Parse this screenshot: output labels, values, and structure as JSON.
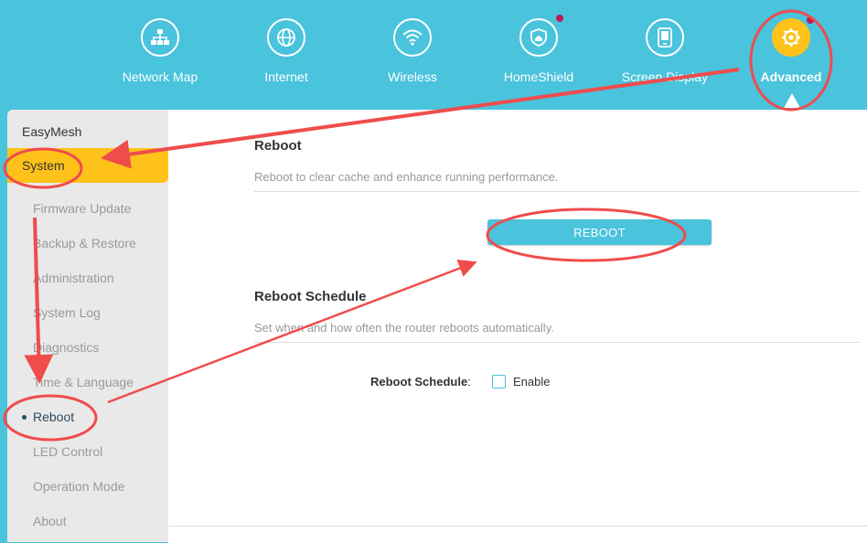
{
  "nav": {
    "items": [
      {
        "label": "Network Map",
        "icon": "network-map-icon"
      },
      {
        "label": "Internet",
        "icon": "globe-icon"
      },
      {
        "label": "Wireless",
        "icon": "wifi-icon"
      },
      {
        "label": "HomeShield",
        "icon": "shield-home-icon"
      },
      {
        "label": "Screen Display",
        "icon": "screen-display-icon"
      },
      {
        "label": "Advanced",
        "icon": "gear-icon"
      }
    ]
  },
  "sidebar": {
    "easymesh": "EasyMesh",
    "system": "System",
    "items": [
      "Firmware Update",
      "Backup & Restore",
      "Administration",
      "System Log",
      "Diagnostics",
      "Time & Language",
      "Reboot",
      "LED Control",
      "Operation Mode",
      "About"
    ]
  },
  "reboot": {
    "title": "Reboot",
    "description": "Reboot to clear cache and enhance running performance.",
    "button": "REBOOT"
  },
  "schedule": {
    "title": "Reboot Schedule",
    "description": "Set when and how often the router reboots automatically.",
    "field_label": "Reboot Schedule",
    "field_colon": ":",
    "enable_label": "Enable"
  },
  "colors": {
    "brand": "#4ac3dc",
    "active": "#ffc21a",
    "annotation": "#ef4c4c"
  }
}
